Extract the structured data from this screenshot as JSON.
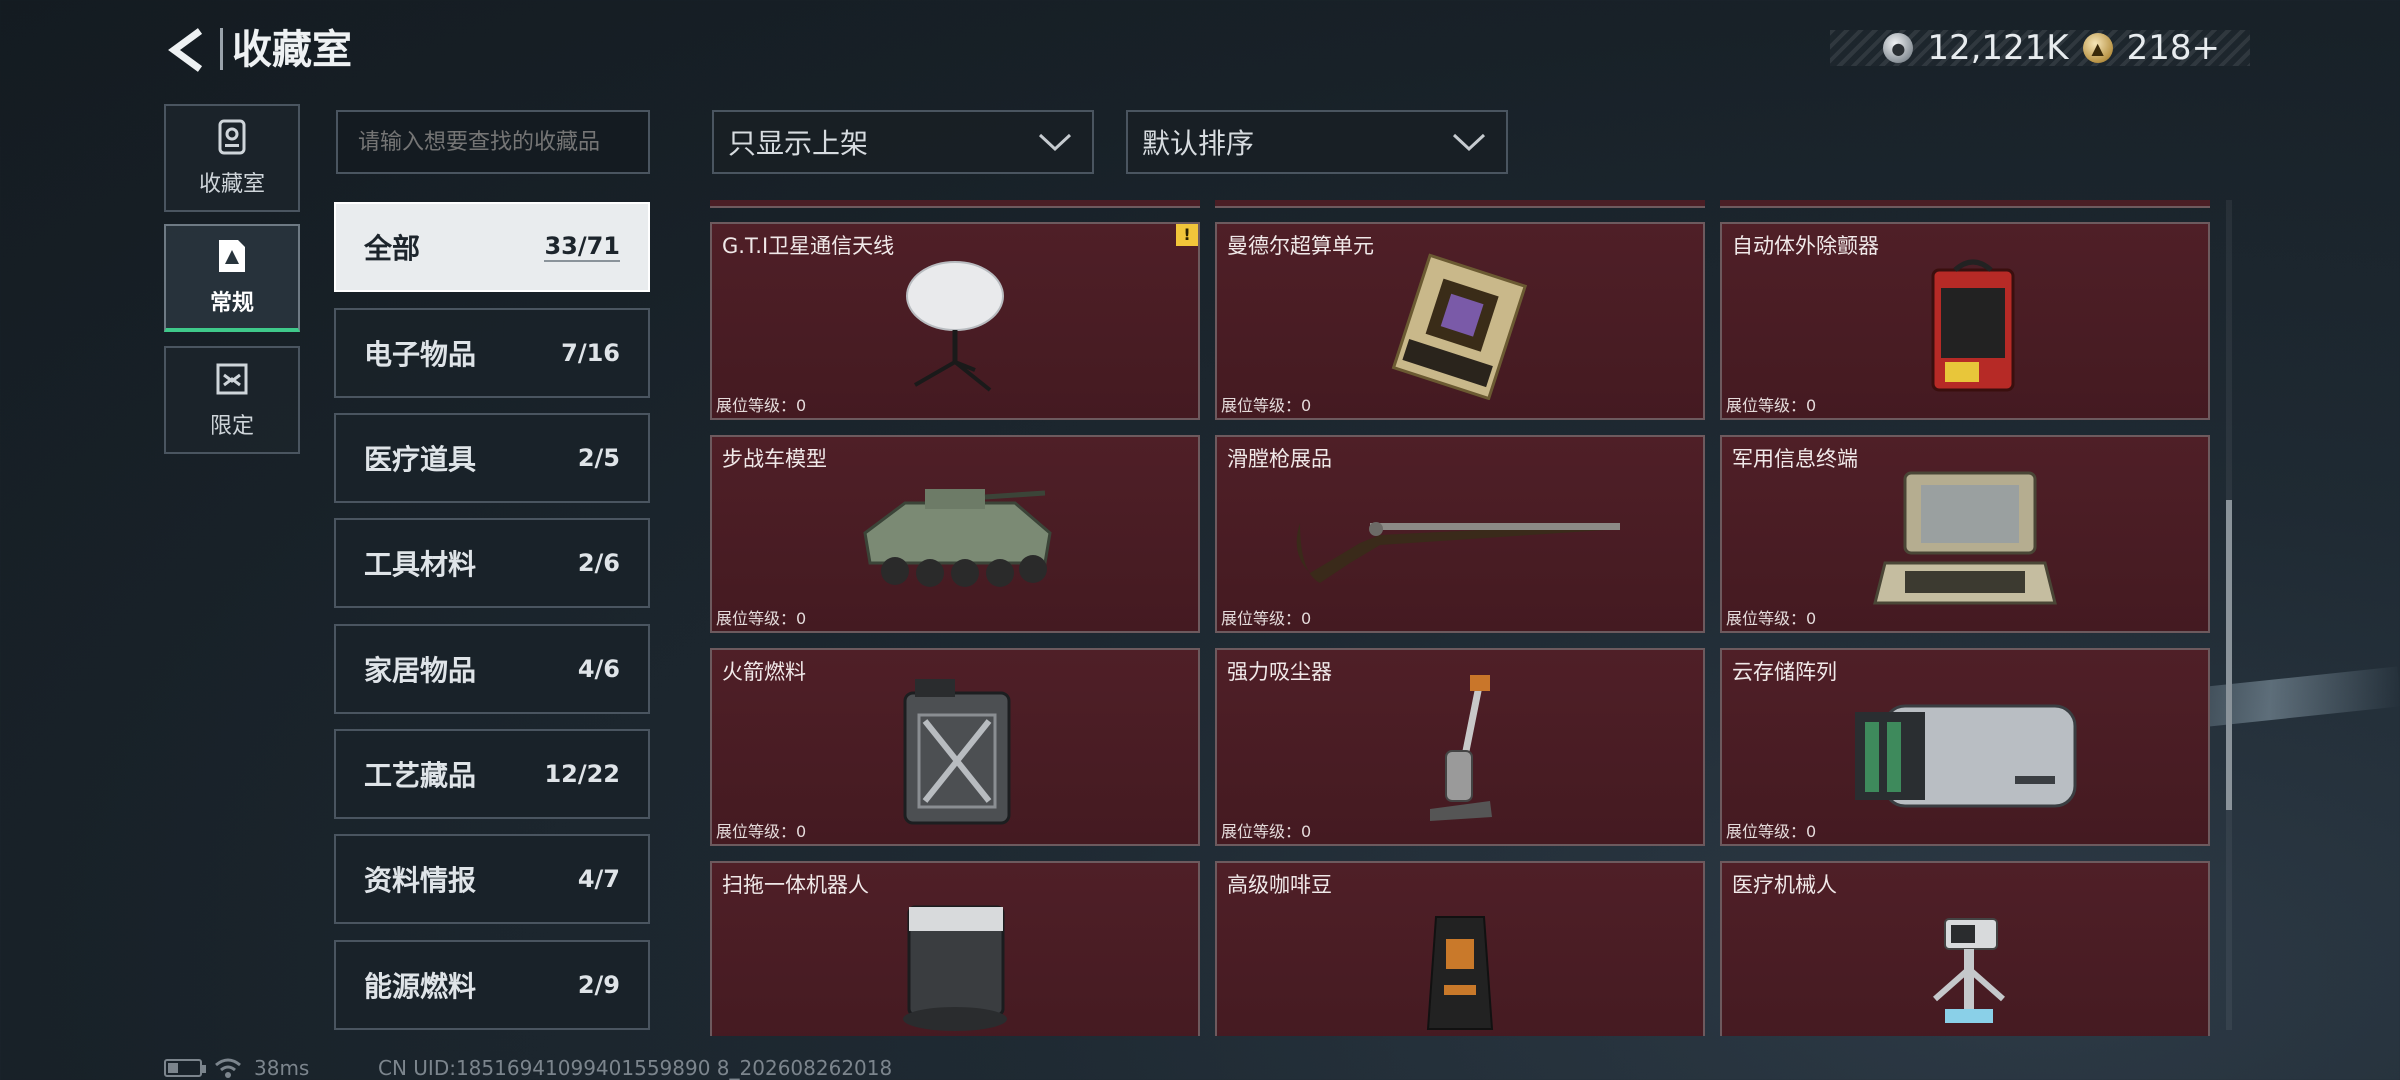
{
  "header": {
    "title": "收藏室",
    "currencies": [
      {
        "icon": "silver-coin-icon",
        "value": "12,121K"
      },
      {
        "icon": "gold-coin-icon",
        "value": "218+"
      }
    ]
  },
  "nav": [
    {
      "label": "收藏室",
      "icon": "collection-room-icon",
      "active": false
    },
    {
      "label": "常规",
      "icon": "regular-icon",
      "active": true
    },
    {
      "label": "限定",
      "icon": "limited-icon",
      "active": false
    }
  ],
  "search": {
    "placeholder": "请输入想要查找的收藏品"
  },
  "categories": [
    {
      "name": "全部",
      "count": "33/71",
      "active": true
    },
    {
      "name": "电子物品",
      "count": "7/16"
    },
    {
      "name": "医疗道具",
      "count": "2/5"
    },
    {
      "name": "工具材料",
      "count": "2/6"
    },
    {
      "name": "家居物品",
      "count": "4/6"
    },
    {
      "name": "工艺藏品",
      "count": "12/22"
    },
    {
      "name": "资料情报",
      "count": "4/7"
    },
    {
      "name": "能源燃料",
      "count": "2/9"
    }
  ],
  "filters": {
    "show": "只显示上架",
    "sort": "默认排序"
  },
  "items": [
    {
      "name": "G.T.I卫星通信天线",
      "level": "展位等级：0",
      "icon": "satellite-dish-icon",
      "badge": "!"
    },
    {
      "name": "曼德尔超算单元",
      "level": "展位等级：0",
      "icon": "supercomputer-board-icon"
    },
    {
      "name": "自动体外除颤器",
      "level": "展位等级：0",
      "icon": "defibrillator-icon"
    },
    {
      "name": "步战车模型",
      "level": "展位等级：0",
      "icon": "armored-vehicle-icon"
    },
    {
      "name": "滑膛枪展品",
      "level": "展位等级：0",
      "icon": "musket-icon"
    },
    {
      "name": "军用信息终端",
      "level": "展位等级：0",
      "icon": "military-terminal-icon"
    },
    {
      "name": "火箭燃料",
      "level": "展位等级：0",
      "icon": "fuel-canister-icon"
    },
    {
      "name": "强力吸尘器",
      "level": "展位等级：0",
      "icon": "vacuum-cleaner-icon"
    },
    {
      "name": "云存储阵列",
      "level": "展位等级：0",
      "icon": "storage-array-icon"
    },
    {
      "name": "扫拖一体机器人",
      "level": "",
      "icon": "robot-mop-icon"
    },
    {
      "name": "高级咖啡豆",
      "level": "",
      "icon": "coffee-bag-icon"
    },
    {
      "name": "医疗机械人",
      "level": "",
      "icon": "medical-robot-icon"
    }
  ],
  "status": {
    "ping": "38ms",
    "uid": "CN UID:18516941099401559890 8_202608262018"
  }
}
